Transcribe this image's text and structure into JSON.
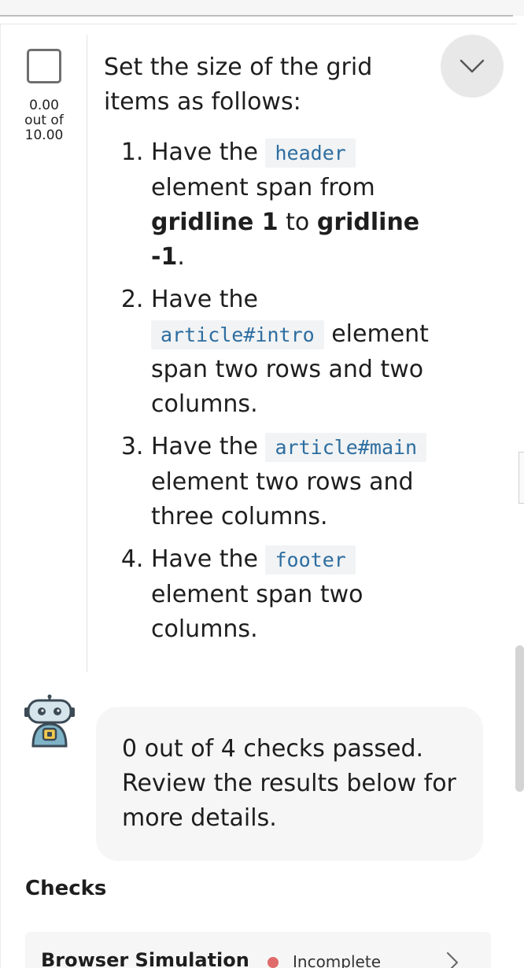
{
  "score": {
    "value": "0.00",
    "out_of_label": "out of",
    "max": "10.00"
  },
  "instructions": {
    "intro": "Set the size of the grid items as follows:",
    "steps": [
      {
        "prefix": "Have the",
        "code": "header",
        "text_a": "element span from",
        "bold_a": "gridline 1",
        "mid": "to",
        "bold_b": "gridline -1",
        "end": "."
      },
      {
        "prefix": "Have the",
        "code": "article#intro",
        "text": "element span two rows and two columns."
      },
      {
        "prefix": "Have the",
        "code": "article#main",
        "text": "element two rows and three columns."
      },
      {
        "prefix": "Have the",
        "code": "footer",
        "text": "element span two columns."
      }
    ]
  },
  "feedback": {
    "message": "0 out of 4 checks passed. Review the results below for more details."
  },
  "checks": {
    "heading": "Checks",
    "items": [
      {
        "title": "Browser Simulation",
        "status": "Incomplete",
        "status_color": "#e06b6b"
      }
    ]
  },
  "icons": {
    "collapse": "chevron-down-icon",
    "robot": "robot-avatar-icon",
    "check_expand": "chevron-right-icon"
  }
}
